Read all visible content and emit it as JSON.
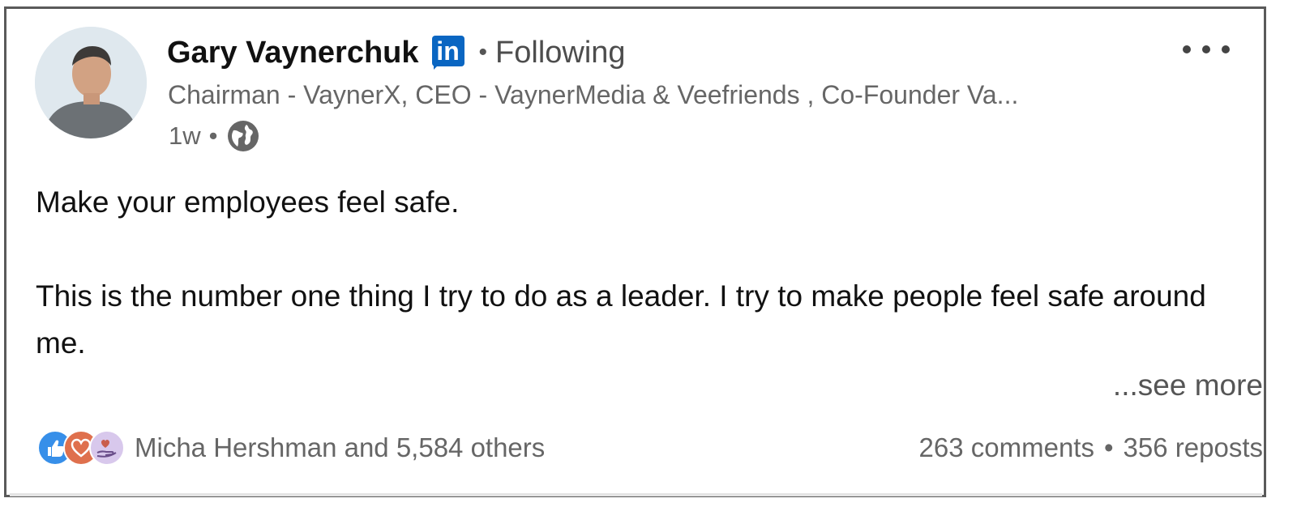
{
  "post": {
    "author": {
      "name": "Gary Vaynerchuk",
      "platform_badge": "in",
      "follow_status": "Following",
      "headline": "Chairman - VaynerX, CEO - VaynerMedia & Veefriends , Co-Founder Va...",
      "time_ago": "1w",
      "visibility_icon": "globe-icon"
    },
    "menu_icon": "more-horizontal-icon",
    "body": {
      "paragraphs": [
        "Make your employees feel safe.",
        "This is the number one thing I try to do as a leader. I try to make people feel safe around me."
      ],
      "see_more": "...see more"
    },
    "social": {
      "reaction_icons": [
        "like-icon",
        "love-icon",
        "support-icon"
      ],
      "reactors_text": "Micha Hershman and 5,584 others",
      "comments": "263 comments",
      "reposts": "356 reposts"
    }
  },
  "colors": {
    "linkedin_blue": "#0a66c2",
    "like": "#378fe9",
    "love": "#df704d",
    "support": "#a78bd0"
  }
}
